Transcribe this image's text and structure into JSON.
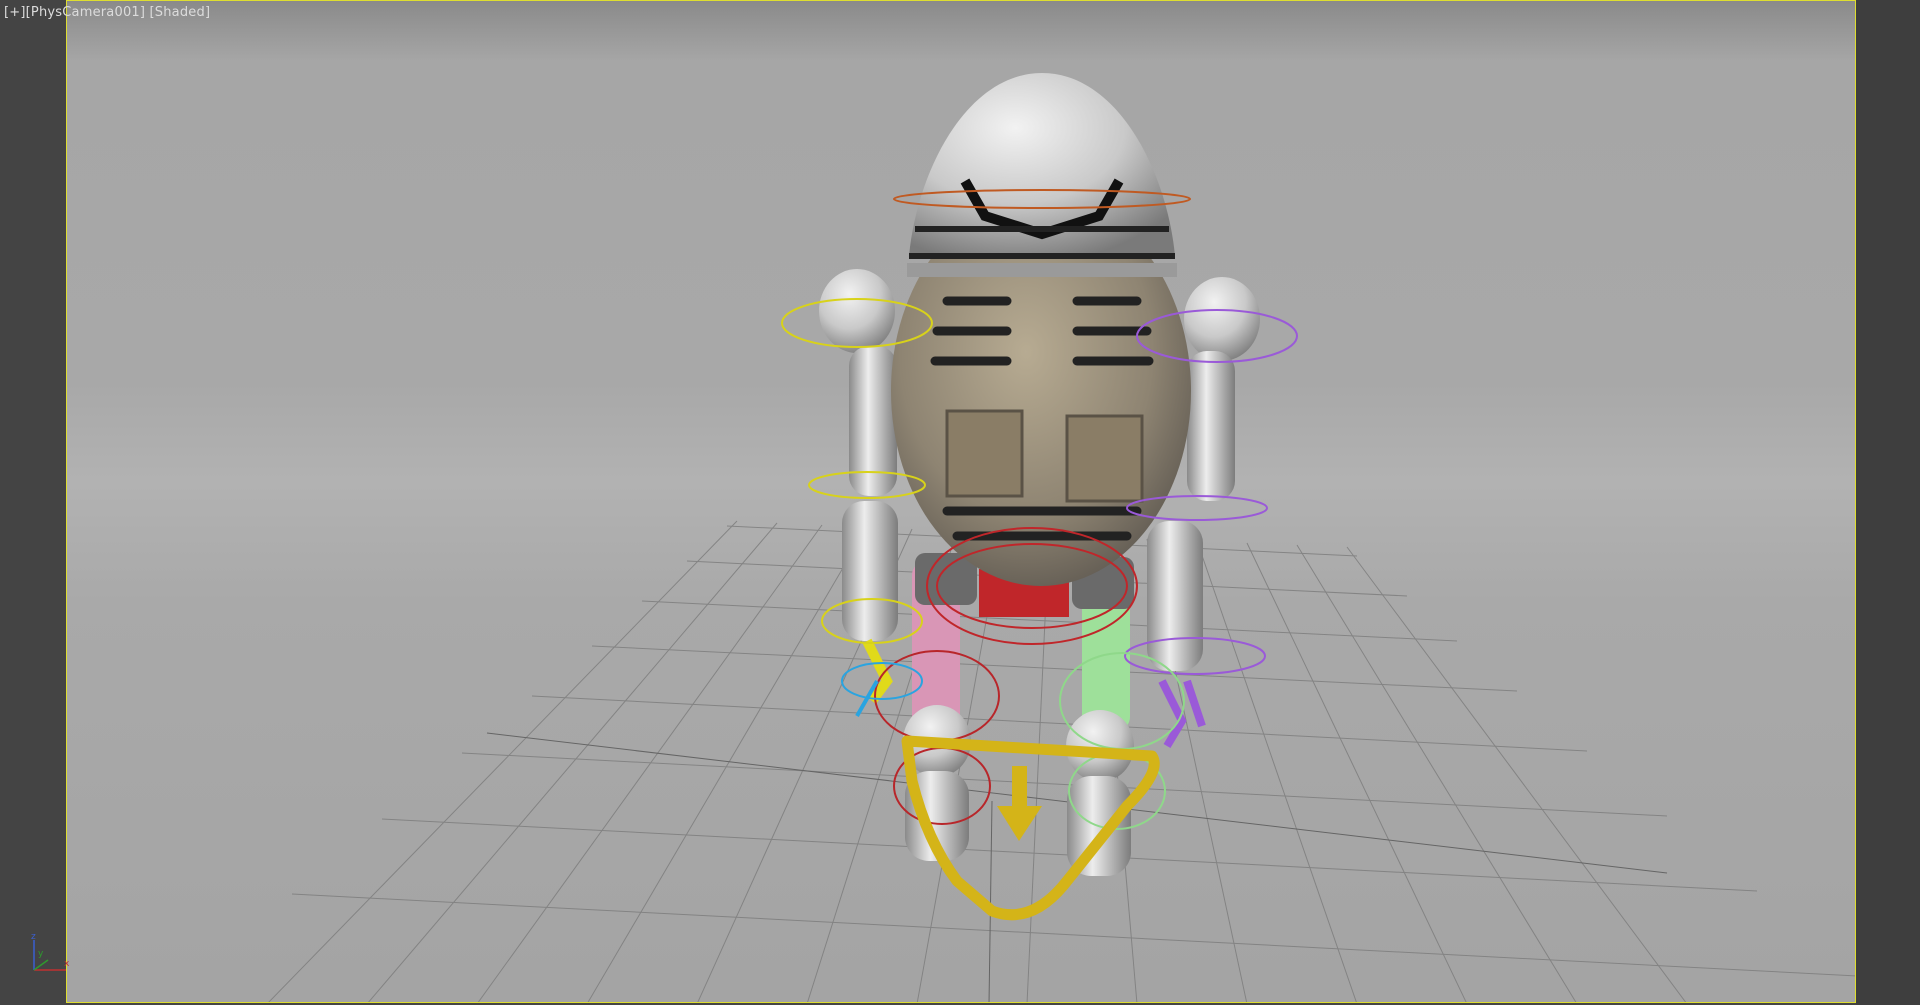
{
  "viewport": {
    "menu_label": "[+]",
    "camera_label": "[PhysCamera001]",
    "shading_label": "[Shaded]",
    "border_color": "#dede30",
    "background_color": "#a8a8a8"
  },
  "axis_gizmo": {
    "z_label": "z",
    "y_label": "y",
    "x_label": "x",
    "z_color": "#3a5fd0",
    "y_color": "#2e9a2e",
    "x_color": "#c03030"
  },
  "scene": {
    "subject": "robot-character-rig",
    "grid": true,
    "rig_colors": {
      "head_control": "#c05a22",
      "left_arm": "#d8d21a",
      "right_arm": "#9a5ad8",
      "left_leg": "#d97aa0",
      "right_leg": "#8fd88a",
      "hip": "#c0262a",
      "foot_control": "#d4b418",
      "left_hand_target": "#2aa4e0"
    }
  }
}
